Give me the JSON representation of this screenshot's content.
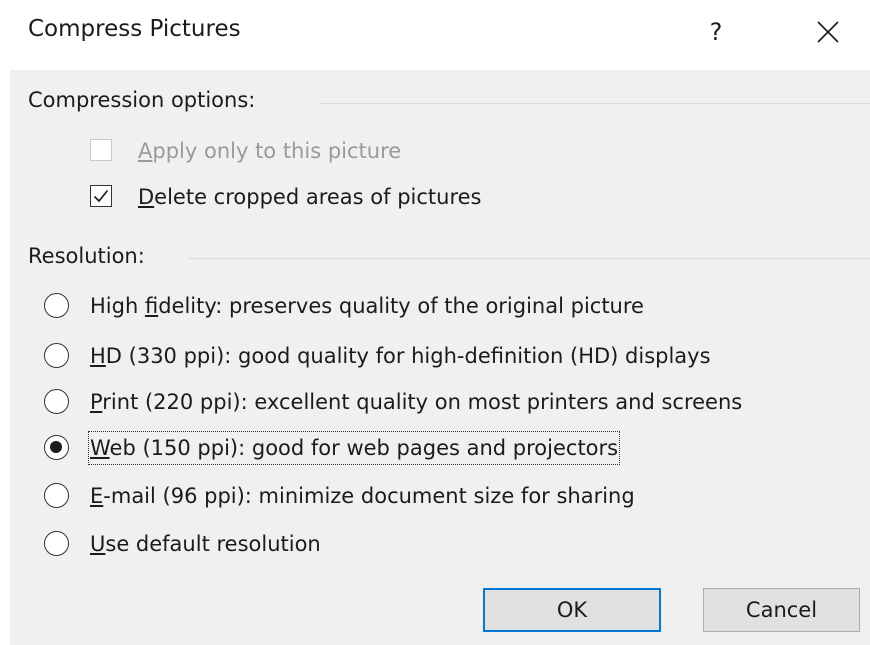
{
  "window": {
    "title": "Compress Pictures",
    "help_label": "?",
    "close_label": "Close"
  },
  "compression": {
    "header": "Compression options:",
    "options": [
      {
        "pre": "",
        "accel": "A",
        "post": "pply only to this picture",
        "checked": false,
        "disabled": true
      },
      {
        "pre": "",
        "accel": "D",
        "post": "elete cropped areas of pictures",
        "checked": true,
        "disabled": false
      }
    ]
  },
  "resolution": {
    "header": "Resolution:",
    "options": [
      {
        "pre": "High ",
        "accel": "f",
        "post": "idelity: preserves quality of the original picture",
        "selected": false
      },
      {
        "pre": "",
        "accel": "H",
        "post": "D (330 ppi): good quality for high-definition (HD) displays",
        "selected": false
      },
      {
        "pre": "",
        "accel": "P",
        "post": "rint (220 ppi): excellent quality on most printers and screens",
        "selected": false
      },
      {
        "pre": "",
        "accel": "W",
        "post": "eb (150 ppi): good for web pages and projectors",
        "selected": true
      },
      {
        "pre": "",
        "accel": "E",
        "post": "-mail (96 ppi): minimize document size for sharing",
        "selected": false
      },
      {
        "pre": "",
        "accel": "U",
        "post": "se default resolution",
        "selected": false
      }
    ]
  },
  "buttons": {
    "ok": "OK",
    "cancel": "Cancel"
  },
  "colors": {
    "accent": "#0078d7",
    "panel": "#f0f0f0",
    "disabled_text": "#9a9a9a"
  }
}
